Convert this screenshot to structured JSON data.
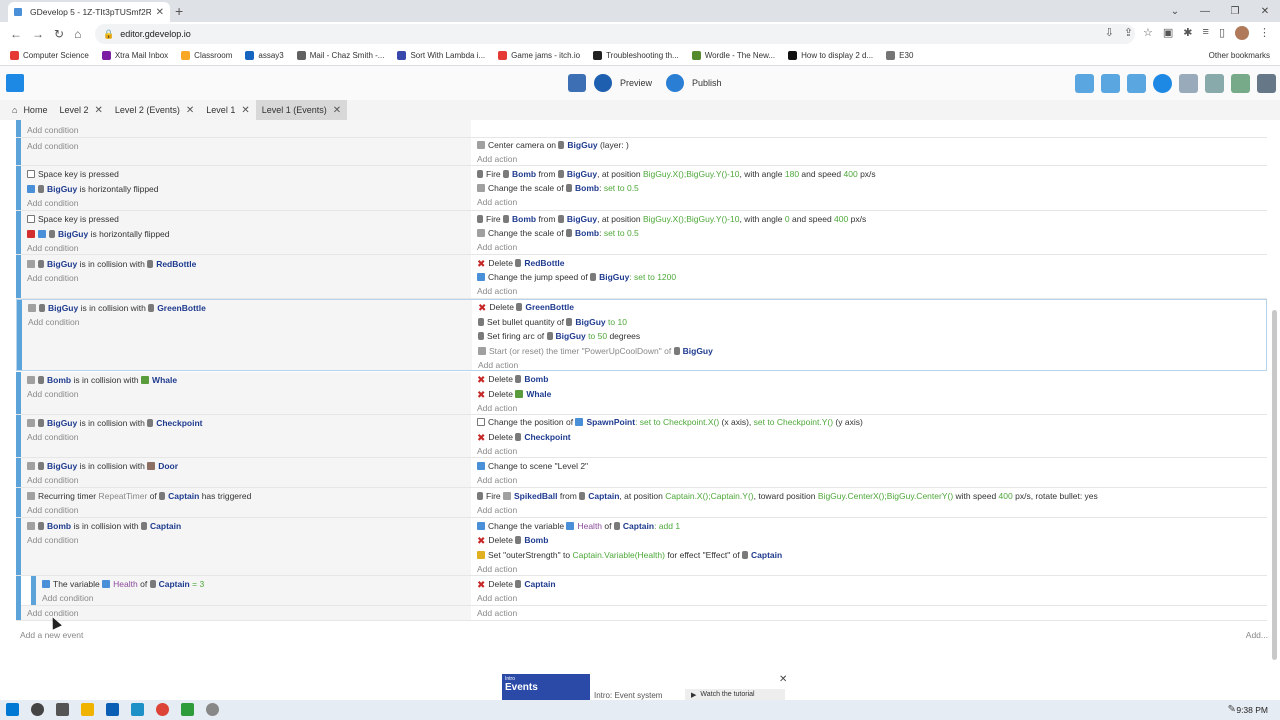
{
  "browser": {
    "tab_title": "GDevelop 5 - 1Z-TIt3pTUSmf2R...",
    "url": "editor.gdevelop.io",
    "bookmarks": [
      "Computer Science",
      "Xtra Mail Inbox",
      "Classroom",
      "assay3",
      "Mail - Chaz Smith -...",
      "Sort With Lambda i...",
      "Game jams - itch.io",
      "Troubleshooting th...",
      "Wordle - The New...",
      "How to display 2 d...",
      "E30"
    ],
    "other_bookmarks": "Other bookmarks"
  },
  "toolbar": {
    "preview": "Preview",
    "publish": "Publish"
  },
  "editor_tabs": [
    {
      "label": "Home"
    },
    {
      "label": "Level 2"
    },
    {
      "label": "Level 2 (Events)"
    },
    {
      "label": "Level 1"
    },
    {
      "label": "Level 1 (Events)"
    }
  ],
  "events": {
    "add_condition": "Add condition",
    "add_action": "Add action",
    "top_cond": "Add condition",
    "e0": {
      "action_text": "Center camera on",
      "obj": "BigGuy",
      "suffix": "(layer: )"
    },
    "e1": {
      "c1": "Space key is pressed",
      "c2_obj": "BigGuy",
      "c2_text": "is horizontally flipped",
      "a1_pre": "Fire",
      "a1_obj1": "Bomb",
      "a1_from": "from",
      "a1_obj2": "BigGuy",
      "a1_mid": ", at position",
      "a1_exp1": "BigGuy.X();BigGuy.Y()-10",
      "a1_angle": ", with angle",
      "a1_exp2": "180",
      "a1_speed": "and speed",
      "a1_exp3": "400",
      "a1_unit": "px/s",
      "a2_pre": "Change the scale of",
      "a2_obj": "Bomb",
      "a2_exp": "set to 0.5"
    },
    "e2": {
      "c1": "Space key is pressed",
      "c2_obj": "BigGuy",
      "c2_text": "is horizontally flipped",
      "a1_pre": "Fire",
      "a1_obj1": "Bomb",
      "a1_from": "from",
      "a1_obj2": "BigGuy",
      "a1_mid": ", at position",
      "a1_exp1": "BigGuy.X();BigGuy.Y()-10",
      "a1_angle": ", with angle",
      "a1_exp2": "0",
      "a1_speed": "and speed",
      "a1_exp3": "400",
      "a1_unit": "px/s",
      "a2_pre": "Change the scale of",
      "a2_obj": "Bomb",
      "a2_exp": "set to 0.5"
    },
    "e3": {
      "c_obj1": "BigGuy",
      "c_text": "is in collision with",
      "c_obj2": "RedBottle",
      "a1_pre": "Delete",
      "a1_obj": "RedBottle",
      "a2_pre": "Change the jump speed of",
      "a2_obj": "BigGuy",
      "a2_exp": ": set to 1200"
    },
    "e4": {
      "c_obj1": "BigGuy",
      "c_text": "is in collision with",
      "c_obj2": "GreenBottle",
      "a1_pre": "Delete",
      "a1_obj": "GreenBottle",
      "a2_pre": "Set bullet quantity of",
      "a2_obj": "BigGuy",
      "a2_exp": "to 10",
      "a3_pre": "Set firing arc of",
      "a3_obj": "BigGuy",
      "a3_exp": "to 50",
      "a3_unit": "degrees",
      "a4_pre": "Start (or reset) the timer \"PowerUpCoolDown\" of",
      "a4_obj": "BigGuy"
    },
    "e5": {
      "c_obj1": "Bomb",
      "c_text": "is in collision with",
      "c_obj2": "Whale",
      "a1_pre": "Delete",
      "a1_obj": "Bomb",
      "a2_pre": "Delete",
      "a2_obj": "Whale"
    },
    "e6": {
      "c_obj1": "BigGuy",
      "c_text": "is in collision with",
      "c_obj2": "Checkpoint",
      "a1_pre": "Change the position of",
      "a1_obj": "SpawnPoint",
      "a1_exp1": ": set to Checkpoint.X()",
      "a1_mid": "(x axis),",
      "a1_exp2": "set to Checkpoint.Y()",
      "a1_end": "(y axis)",
      "a2_pre": "Delete",
      "a2_obj": "Checkpoint"
    },
    "e7": {
      "c_obj1": "BigGuy",
      "c_text": "is in collision with",
      "c_obj2": "Door",
      "a1_pre": "Change to scene \"Level 2\""
    },
    "e8": {
      "c_pre": "Recurring timer",
      "c_name": "RepeatTimer",
      "c_of": "of",
      "c_obj": "Captain",
      "c_end": "has triggered",
      "a1_pre": "Fire",
      "a1_obj1": "SpikedBall",
      "a1_from": "from",
      "a1_obj2": "Captain",
      "a1_mid": ", at position",
      "a1_exp1": "Captain.X();Captain.Y()",
      "a1_toward": ", toward position",
      "a1_exp2": "BigGuy.CenterX();BigGuy.CenterY()",
      "a1_with": "with speed",
      "a1_exp3": "400",
      "a1_end": "px/s, rotate bullet: yes"
    },
    "e9": {
      "c_obj1": "Bomb",
      "c_text": "is in collision with",
      "c_obj2": "Captain",
      "a1_pre": "Change the variable",
      "a1_var": "Health",
      "a1_of": "of",
      "a1_obj": "Captain",
      "a1_exp": ": add 1",
      "a2_pre": "Delete",
      "a2_obj": "Bomb",
      "a3_pre": "Set \"outerStrength\" to",
      "a3_exp": "Captain.Variable(Health)",
      "a3_mid": "for effect \"Effect\" of",
      "a3_obj": "Captain"
    },
    "e10": {
      "c_pre": "The variable",
      "c_var": "Health",
      "c_of": "of",
      "c_obj": "Captain",
      "c_exp": "= 3",
      "a1_pre": "Delete",
      "a1_obj": "Captain"
    },
    "add_event": "Add a new event",
    "add_right": "Add..."
  },
  "tutorial": {
    "thumb_small": "Intro",
    "thumb_big": "Events",
    "label": "Intro: Event system",
    "watch": "Watch the tutorial"
  },
  "taskbar": {
    "time": "9:38 PM"
  }
}
